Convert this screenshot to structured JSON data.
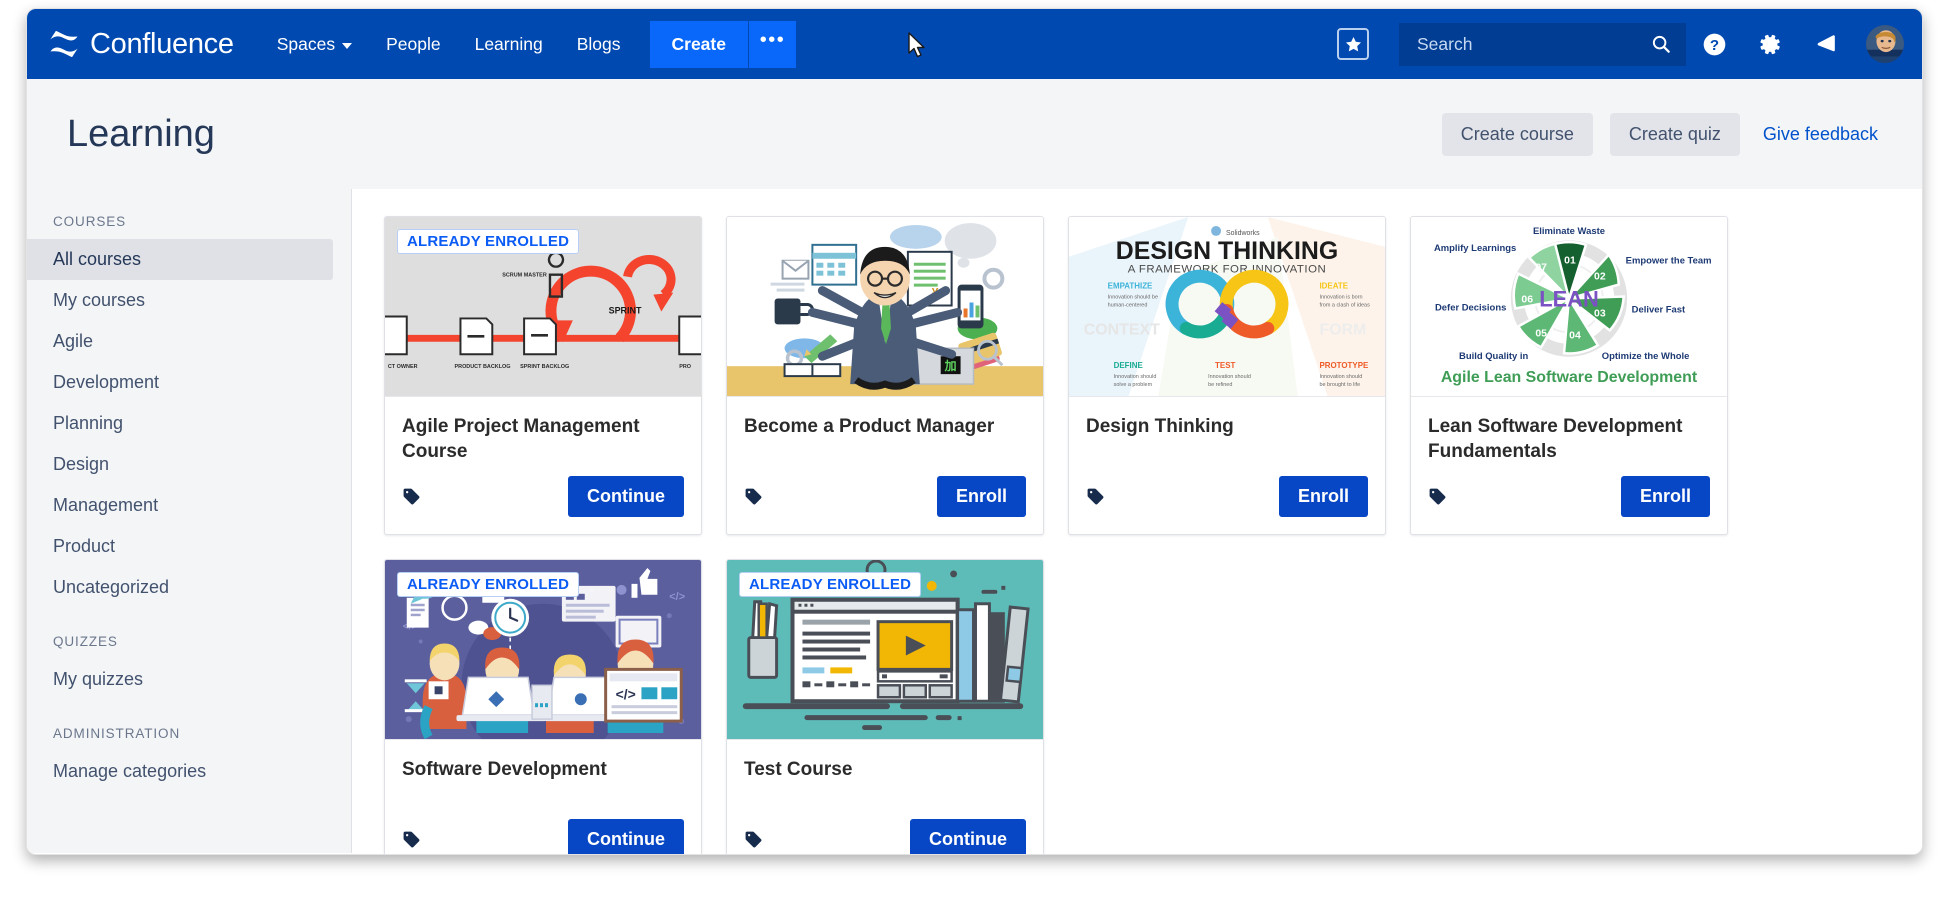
{
  "navbar": {
    "brand": "Confluence",
    "links": [
      {
        "label": "Spaces",
        "has_caret": true
      },
      {
        "label": "People",
        "has_caret": false
      },
      {
        "label": "Learning",
        "has_caret": false
      },
      {
        "label": "Blogs",
        "has_caret": false
      }
    ],
    "create_label": "Create",
    "create_more_label": "•••",
    "star_icon": "star-icon",
    "search_placeholder": "Search",
    "search_value": "",
    "search_icon": "search-icon",
    "help_icon": "help-icon",
    "settings_icon": "gear-icon",
    "notifications_icon": "megaphone-icon",
    "avatar_icon": "user-avatar",
    "accent_color": "#0049b0",
    "create_color": "#0968fa"
  },
  "header": {
    "title": "Learning",
    "create_course_label": "Create course",
    "create_quiz_label": "Create quiz",
    "give_feedback_label": "Give feedback",
    "link_color": "#0052cc"
  },
  "sidebar": {
    "sections": [
      {
        "title": "COURSES",
        "items": [
          {
            "label": "All courses",
            "active": true
          },
          {
            "label": "My courses",
            "active": false
          },
          {
            "label": "Agile",
            "active": false
          },
          {
            "label": "Development",
            "active": false
          },
          {
            "label": "Planning",
            "active": false
          },
          {
            "label": "Design",
            "active": false
          },
          {
            "label": "Management",
            "active": false
          },
          {
            "label": "Product",
            "active": false
          },
          {
            "label": "Uncategorized",
            "active": false
          }
        ]
      },
      {
        "title": "QUIZZES",
        "items": [
          {
            "label": "My quizzes",
            "active": false
          }
        ]
      },
      {
        "title": "ADMINISTRATION",
        "items": [
          {
            "label": "Manage categories",
            "active": false
          }
        ]
      }
    ]
  },
  "courses": [
    {
      "title": "Agile Project Management Course",
      "action_label": "Continue",
      "badge": "ALREADY ENROLLED",
      "thumb": "agile-scrum-diagram",
      "thumb_texts": {
        "sprint": "SPRINT",
        "scrum_master": "SCRUM MASTER",
        "product_backlog": "PRODUCT BACKLOG",
        "sprint_backlog": "SPRINT BACKLOG",
        "product_owner": "PRODUCT OWNER"
      }
    },
    {
      "title": "Become a Product Manager",
      "action_label": "Enroll",
      "badge": "",
      "thumb": "product-manager-illustration",
      "thumb_texts": {}
    },
    {
      "title": "Design Thinking",
      "action_label": "Enroll",
      "badge": "",
      "thumb": "design-thinking-infinity",
      "thumb_texts": {
        "heading": "DESIGN THINKING",
        "subheading": "A FRAMEWORK FOR INNOVATION",
        "context": "CONTEXT",
        "form": "FORM",
        "empathize": "EMPATHIZE",
        "ideate": "IDEATE",
        "define": "DEFINE",
        "test": "TEST",
        "prototype": "PROTOTYPE"
      }
    },
    {
      "title": "Lean Software Development Fundamentals",
      "action_label": "Enroll",
      "badge": "",
      "thumb": "lean-wheel-diagram",
      "thumb_texts": {
        "center": "LEAN",
        "caption": "Agile Lean Software Development",
        "s01": "Eliminate Waste",
        "s02": "Empower the Team",
        "s03": "Deliver Fast",
        "s04": "Optimize the Whole",
        "s05": "Build Quality in",
        "s06": "Defer Decisions",
        "s07": "Amplify Learnings",
        "n01": "01",
        "n02": "02",
        "n03": "03",
        "n04": "04",
        "n05": "05",
        "n06": "06",
        "n07": "07"
      }
    },
    {
      "title": "Software Development",
      "action_label": "Continue",
      "badge": "ALREADY ENROLLED",
      "thumb": "dev-team-illustration",
      "thumb_texts": {
        "code": "</>"
      }
    },
    {
      "title": "Test Course",
      "action_label": "Continue",
      "badge": "ALREADY ENROLLED",
      "thumb": "elearning-illustration",
      "thumb_texts": {}
    }
  ]
}
